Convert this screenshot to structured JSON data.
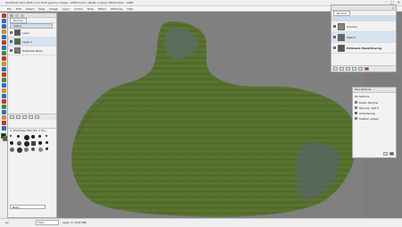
{
  "window": {
    "title": "[Untitled]-10.0 (RGB color 8-bit gamma integer, GIMP built-in sRGB, 1 layer) 1800x1200 – GIMP",
    "controls": [
      "–",
      "□",
      "×"
    ]
  },
  "menu": [
    "File",
    "Edit",
    "Select",
    "View",
    "Image",
    "Layer",
    "Colors",
    "Tools",
    "Filters",
    "Windows",
    "Help"
  ],
  "layers_left": {
    "mode": "Normal",
    "opacity": "100.0",
    "items": [
      {
        "name": "Layer"
      },
      {
        "name": "Layer 1"
      },
      {
        "name": "Hillshade Mask"
      }
    ]
  },
  "brushes": {
    "label": "2. Hardness 050 (51 × 51)",
    "preset": "Basic"
  },
  "layers_right": {
    "mode": "Normal",
    "items": [
      {
        "name": "Overlay"
      },
      {
        "name": "Sketch"
      },
      {
        "name": "Hillshade Mask/Overlay"
      }
    ]
  },
  "tool_options": {
    "title": "Tool Options",
    "section": "Fill Options",
    "options": [
      "Mode: Normal",
      "Opacity: 100.0",
      "Antialiasing",
      "Feather edges"
    ]
  },
  "status": {
    "unit": "px",
    "zoom": "50%",
    "info": "Layer 1 (74.8 MB)"
  },
  "colors": {
    "land": "#56702f",
    "land_dark": "#3f5624",
    "rock": "#5f6b6c",
    "canvas": "#808080"
  }
}
